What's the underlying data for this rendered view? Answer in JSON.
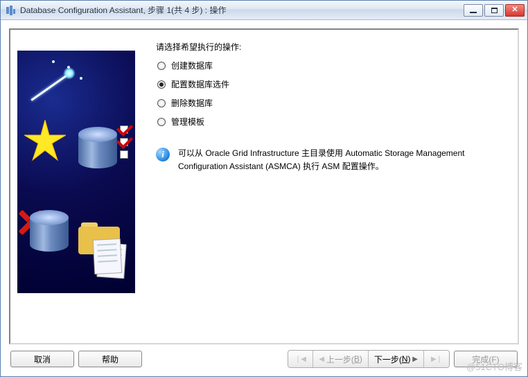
{
  "window": {
    "title": "Database Configuration Assistant, 步骤 1(共 4 步) : 操作"
  },
  "instruction": "请选择希望执行的操作:",
  "options": [
    {
      "label": "创建数据库",
      "selected": false
    },
    {
      "label": "配置数据库选件",
      "selected": true
    },
    {
      "label": "删除数据库",
      "selected": false
    },
    {
      "label": "管理模板",
      "selected": false
    }
  ],
  "info": {
    "icon_letter": "i",
    "text": "可以从 Oracle Grid Infrastructure 主目录使用 Automatic Storage Management Configuration Assistant (ASMCA) 执行 ASM 配置操作。"
  },
  "buttons": {
    "cancel": "取消",
    "help": "帮助",
    "back_prefix": "上一步(",
    "back_key": "B",
    "next_prefix": "下一步(",
    "next_key": "N",
    "paren_close": ")",
    "finish": "完成(F)"
  },
  "watermark": "@51CTO博客"
}
